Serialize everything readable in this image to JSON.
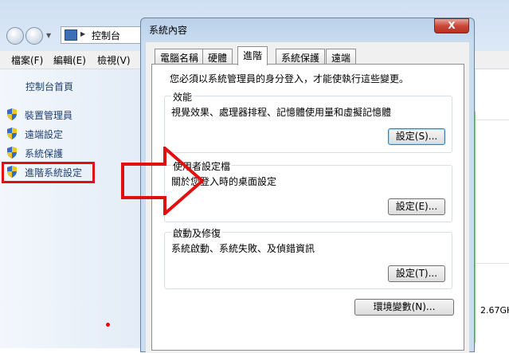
{
  "background_window": {
    "address": {
      "path": "控制台"
    },
    "menu": [
      "檔案(F)",
      "編輯(E)",
      "檢視(V)"
    ],
    "left_pane": {
      "home_link": "控制台首頁",
      "tasks": [
        {
          "label": "裝置管理員"
        },
        {
          "label": "遠端設定"
        },
        {
          "label": "系統保護"
        },
        {
          "label": "進階系統設定"
        }
      ]
    },
    "right_text": "2.67GH"
  },
  "dialog": {
    "title": "系統內容",
    "close_label": "X",
    "tabs": [
      {
        "label": "電腦名稱"
      },
      {
        "label": "硬體"
      },
      {
        "label": "進階"
      },
      {
        "label": "系統保護"
      },
      {
        "label": "遠端"
      }
    ],
    "active_tab": "進階",
    "admin_note": "您必須以系統管理員的身分登入，才能使執行這些變更。",
    "performance": {
      "title": "效能",
      "description": "視覺效果、處理器排程、記憶體使用量和虛擬記憶體",
      "button": "設定(S)..."
    },
    "user_profiles": {
      "title": "使用者設定檔",
      "description": "關於您登入時的桌面設定",
      "button": "設定(E)..."
    },
    "startup_recovery": {
      "title": "啟動及修復",
      "description": "系統啟動、系統失敗、及偵錯資訊",
      "button": "設定(T)..."
    },
    "env_button": "環境變數(N)..."
  },
  "colors": {
    "highlight_box": "#e01010",
    "arrow_outline": "#e01010",
    "dialog_frame": "#c9dcf0"
  }
}
